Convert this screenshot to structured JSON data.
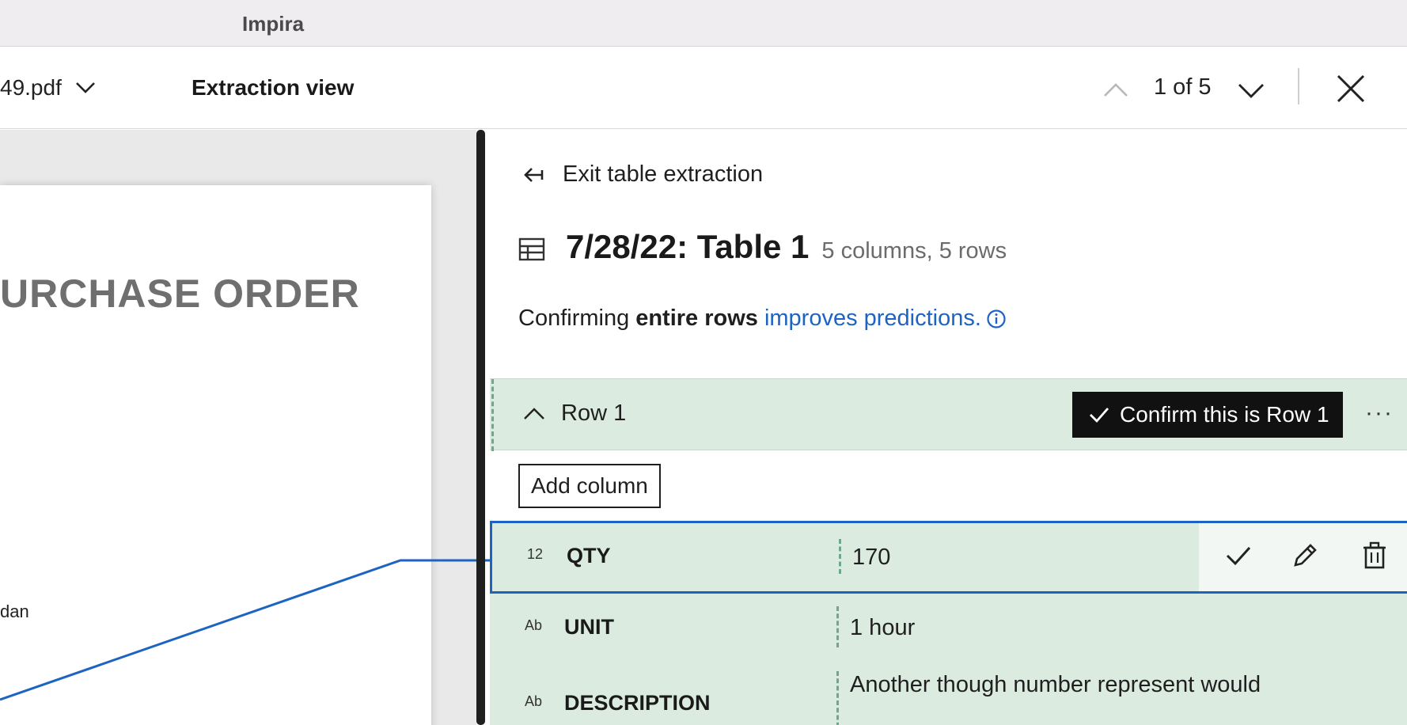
{
  "window": {
    "title": "Impira"
  },
  "toolbar": {
    "file_name": "49.pdf",
    "view_title": "Extraction view",
    "page_indicator": "1 of 5"
  },
  "document": {
    "heading": "URCHASE ORDER",
    "fragment": "dan"
  },
  "panel": {
    "exit_label": "Exit table extraction",
    "table_name": "7/28/22: Table 1",
    "table_meta": "5 columns, 5 rows",
    "hint": {
      "prefix": "Confirming",
      "bold": "entire rows",
      "link": "improves predictions."
    },
    "row": {
      "label": "Row 1",
      "confirm_label": "Confirm this is Row 1",
      "more": "···"
    },
    "add_column_label": "Add column",
    "fields": [
      {
        "type": "12",
        "name": "QTY",
        "value": "170"
      },
      {
        "type": "Ab",
        "name": "UNIT",
        "value": "1 hour"
      },
      {
        "type": "Ab",
        "name": "DESCRIPTION",
        "value": "Another though number represent would"
      }
    ]
  },
  "colors": {
    "accent": "#1d63c2",
    "row_bg": "#dcebe0",
    "dash": "#6fa889"
  }
}
